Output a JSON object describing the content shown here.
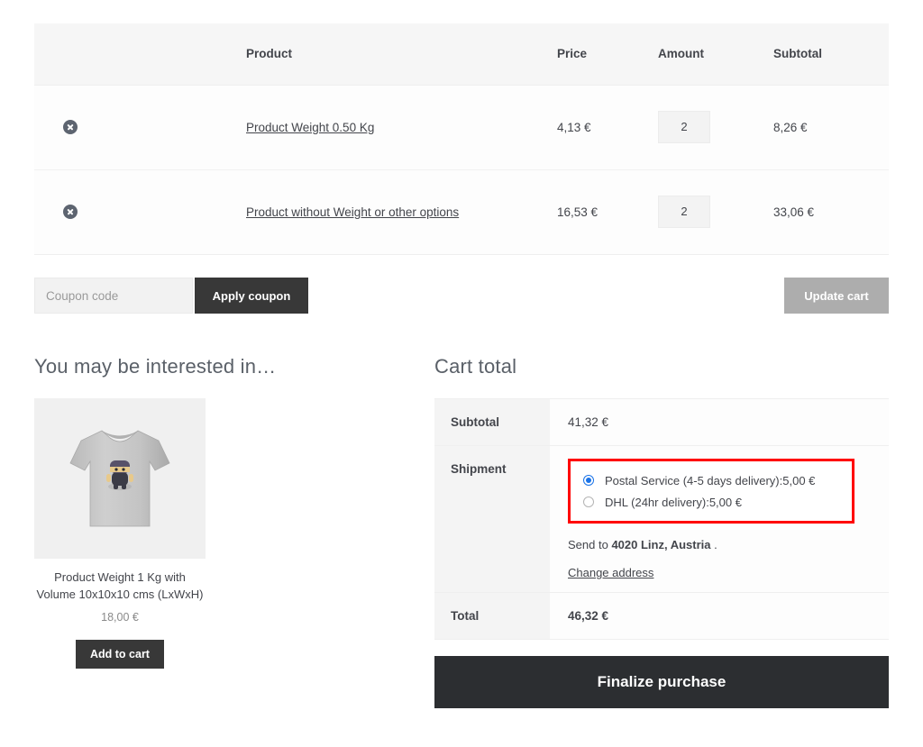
{
  "cart_table": {
    "headers": {
      "remove": "",
      "thumbnail": "",
      "product": "Product",
      "price": "Price",
      "amount": "Amount",
      "subtotal": "Subtotal"
    },
    "rows": [
      {
        "remove_label": "×",
        "product": "Product Weight 0.50 Kg",
        "price": "4,13 €",
        "amount": "2",
        "subtotal": "8,26 €"
      },
      {
        "remove_label": "×",
        "product": "Product without Weight or other options",
        "price": "16,53 €",
        "amount": "2",
        "subtotal": "33,06 €"
      }
    ]
  },
  "coupon": {
    "placeholder": "Coupon code",
    "value": "",
    "apply_label": "Apply coupon",
    "update_label": "Update cart"
  },
  "upsell": {
    "title": "You may be interested in…",
    "product": {
      "name": "Product Weight 1 Kg with Volume 10x10x10 cms (LxWxH)",
      "price": "18,00 €",
      "add_label": "Add to cart",
      "image_alt": "gray t-shirt with ninja graphic"
    }
  },
  "totals": {
    "title": "Cart total",
    "subtotal_label": "Subtotal",
    "subtotal_value": "41,32 €",
    "shipment_label": "Shipment",
    "shipment_options": [
      {
        "label": "Postal Service (4-5 days delivery):5,00 €",
        "selected": true
      },
      {
        "label": "DHL (24hr delivery):5,00 €",
        "selected": false
      }
    ],
    "send_to_prefix": "Send to ",
    "send_to_address": "4020 Linz, Austria",
    "send_to_suffix": " .",
    "change_address_label": "Change address",
    "total_label": "Total",
    "total_value": "46,32 €",
    "finalize_label": "Finalize purchase"
  },
  "colors": {
    "highlight": "#ff0000",
    "radio_selected": "#1a73e8",
    "dark_button": "#383838",
    "finalize_button": "#2c2e31",
    "disabled_button": "#adadad"
  }
}
